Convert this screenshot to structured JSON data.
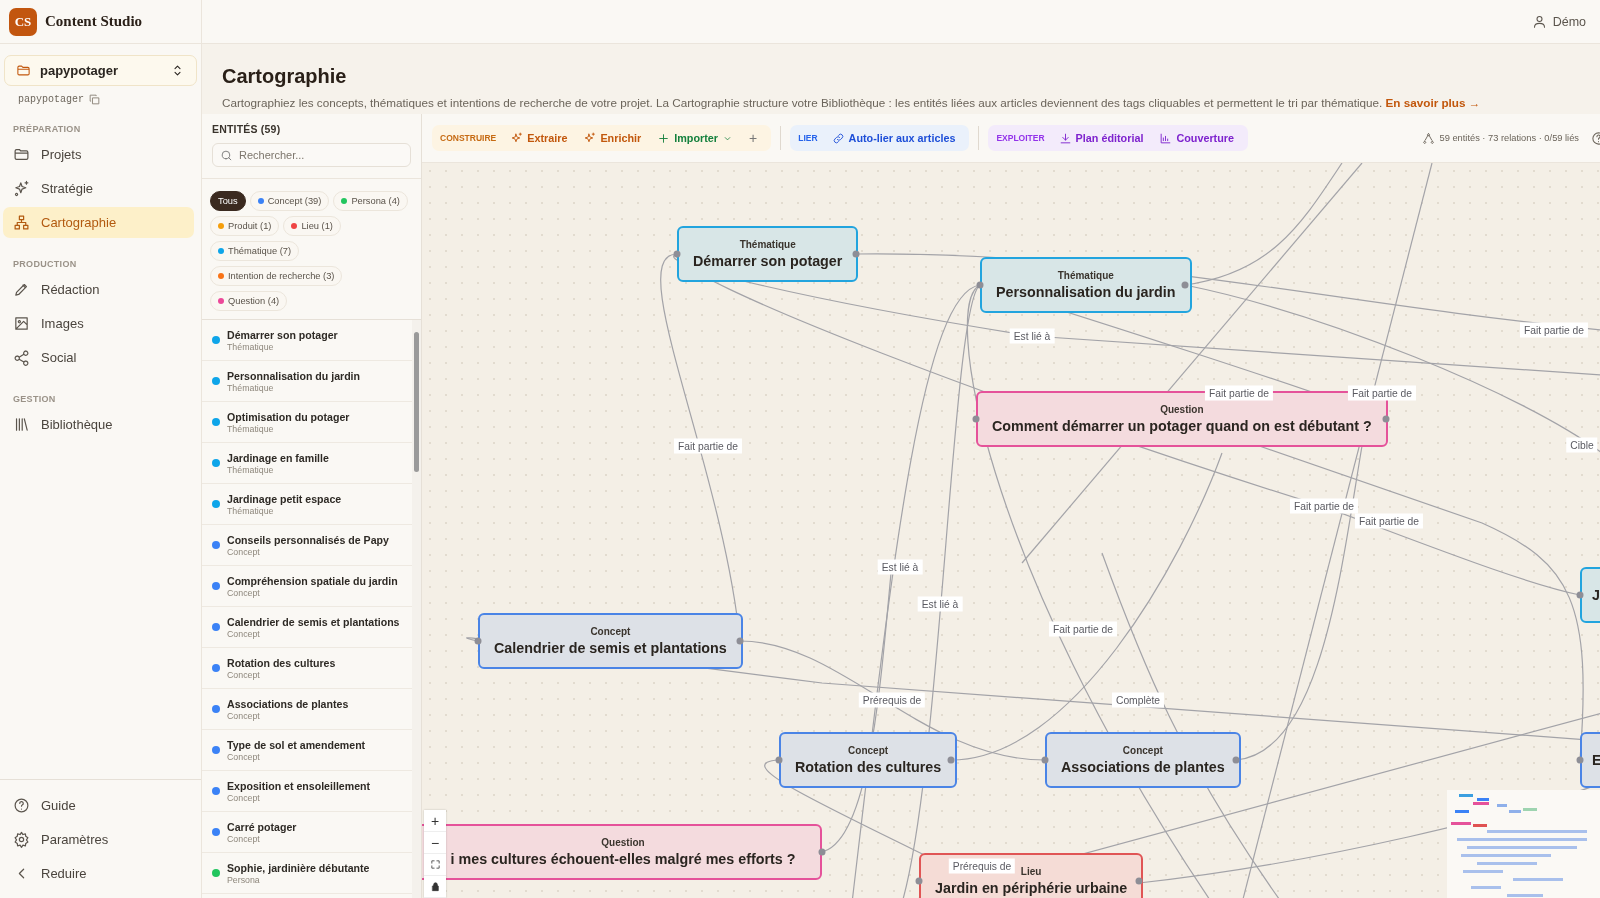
{
  "app": {
    "logo": "CS",
    "name": "Content Studio"
  },
  "project": {
    "name": "papypotager",
    "slug": "papypotager"
  },
  "nav": [
    {
      "section": "PRÉPARATION",
      "items": [
        {
          "label": "Projets",
          "kind": "folder",
          "selected": false
        },
        {
          "label": "Stratégie",
          "kind": "sparkle",
          "selected": false
        },
        {
          "label": "Cartographie",
          "kind": "network",
          "selected": true
        }
      ]
    },
    {
      "section": "PRODUCTION",
      "items": [
        {
          "label": "Rédaction",
          "kind": "pen",
          "selected": false
        },
        {
          "label": "Images",
          "kind": "image",
          "selected": false
        },
        {
          "label": "Social",
          "kind": "share",
          "selected": false
        }
      ]
    },
    {
      "section": "GESTION",
      "items": [
        {
          "label": "Bibliothèque",
          "kind": "library",
          "selected": false
        }
      ]
    }
  ],
  "footer_nav": [
    {
      "label": "Guide",
      "kind": "help"
    },
    {
      "label": "Paramètres",
      "kind": "gear"
    },
    {
      "label": "Reduire",
      "kind": "chevron"
    }
  ],
  "user": {
    "name": "Démo"
  },
  "page": {
    "title": "Cartographie",
    "description": "Cartographiez les concepts, thématiques et intentions de recherche de votre projet. La Cartographie structure votre Bibliothèque : les entités liées aux articles deviennent des tags cliquables et permettent le tri par thématique.",
    "link": "En savoir plus →"
  },
  "entities": {
    "title": "ENTITÉS (59)",
    "search_placeholder": "Rechercher...",
    "filters": [
      {
        "label": "Tous",
        "selected": true
      },
      {
        "label": "Concept (39)",
        "color": "#3b82f6",
        "selected": false
      },
      {
        "label": "Persona (4)",
        "color": "#22c55e",
        "selected": false
      },
      {
        "label": "Produit (1)",
        "color": "#f59e0b",
        "selected": false
      },
      {
        "label": "Lieu (1)",
        "color": "#ef4444",
        "selected": false
      },
      {
        "label": "Thématique (7)",
        "color": "#0ea5e9",
        "selected": false
      },
      {
        "label": "Intention de recherche (3)",
        "color": "#f97316",
        "selected": false
      },
      {
        "label": "Question (4)",
        "color": "#ec4899",
        "selected": false
      }
    ],
    "items": [
      {
        "name": "Démarrer son potager",
        "type": "Thématique",
        "color": "#0ea5e9"
      },
      {
        "name": "Personnalisation du jardin",
        "type": "Thématique",
        "color": "#0ea5e9"
      },
      {
        "name": "Optimisation du potager",
        "type": "Thématique",
        "color": "#0ea5e9"
      },
      {
        "name": "Jardinage en famille",
        "type": "Thématique",
        "color": "#0ea5e9"
      },
      {
        "name": "Jardinage petit espace",
        "type": "Thématique",
        "color": "#0ea5e9"
      },
      {
        "name": "Conseils personnalisés de Papy",
        "type": "Concept",
        "color": "#3b82f6"
      },
      {
        "name": "Compréhension spatiale du jardin",
        "type": "Concept",
        "color": "#3b82f6"
      },
      {
        "name": "Calendrier de semis et plantations",
        "type": "Concept",
        "color": "#3b82f6"
      },
      {
        "name": "Rotation des cultures",
        "type": "Concept",
        "color": "#3b82f6"
      },
      {
        "name": "Associations de plantes",
        "type": "Concept",
        "color": "#3b82f6"
      },
      {
        "name": "Type de sol et amendement",
        "type": "Concept",
        "color": "#3b82f6"
      },
      {
        "name": "Exposition et ensoleillement",
        "type": "Concept",
        "color": "#3b82f6"
      },
      {
        "name": "Carré potager",
        "type": "Concept",
        "color": "#3b82f6"
      },
      {
        "name": "Sophie, jardinière débutante",
        "type": "Persona",
        "color": "#22c55e"
      }
    ]
  },
  "toolbar": {
    "groups": [
      {
        "label": "CONSTRUIRE",
        "kind": "build",
        "actions": [
          {
            "label": "Extraire",
            "kind": "ai",
            "dropdown": false
          },
          {
            "label": "Enrichir",
            "kind": "ai",
            "dropdown": false
          },
          {
            "label": "Importer",
            "kind": "import",
            "dropdown": true
          },
          {
            "label": "+",
            "kind": "more",
            "dropdown": false
          }
        ]
      },
      {
        "label": "LIER",
        "kind": "link",
        "actions": [
          {
            "label": "Auto-lier aux articles",
            "kind": "link",
            "dropdown": false
          }
        ]
      },
      {
        "label": "EXPLOITER",
        "kind": "exploit",
        "actions": [
          {
            "label": "Plan éditorial",
            "kind": "download",
            "dropdown": false
          },
          {
            "label": "Couverture",
            "kind": "chart",
            "dropdown": false
          }
        ]
      }
    ],
    "stats": "59 entités · 73 relations · 0/59 liés"
  },
  "graph": {
    "nodes": [
      {
        "kind": "thematique",
        "type": "Thématique",
        "title": "Démarrer son potager"
      },
      {
        "kind": "thematique",
        "type": "Thématique",
        "title": "Personnalisation du jardin"
      },
      {
        "kind": "question",
        "type": "Question",
        "title": "Comment démarrer un potager quand on est débutant ?"
      },
      {
        "kind": "concept",
        "type": "Concept",
        "title": "Calendrier de semis et plantations"
      },
      {
        "kind": "concept",
        "type": "Concept",
        "title": "Rotation des cultures"
      },
      {
        "kind": "concept",
        "type": "Concept",
        "title": "Associations de plantes"
      },
      {
        "kind": "question",
        "type": "Question",
        "title": "i mes cultures échouent-elles malgré mes efforts ?"
      },
      {
        "kind": "lieu",
        "type": "Lieu",
        "title": "Jardin en périphérie urbaine"
      },
      {
        "kind": "thematique",
        "title": "J"
      },
      {
        "kind": "concept",
        "title": "E"
      }
    ],
    "edge_labels": [
      "Est lié à",
      "Fait partie de",
      "Fait partie de",
      "Fait partie de",
      "Fait partie de",
      "Cible",
      "Fait partie de",
      "Fait partie de",
      "Est lié à",
      "Est lié à",
      "Fait partie de",
      "Prérequis de",
      "Complète",
      "Prérequis de"
    ],
    "zoom_controls": [
      "+",
      "−"
    ]
  }
}
